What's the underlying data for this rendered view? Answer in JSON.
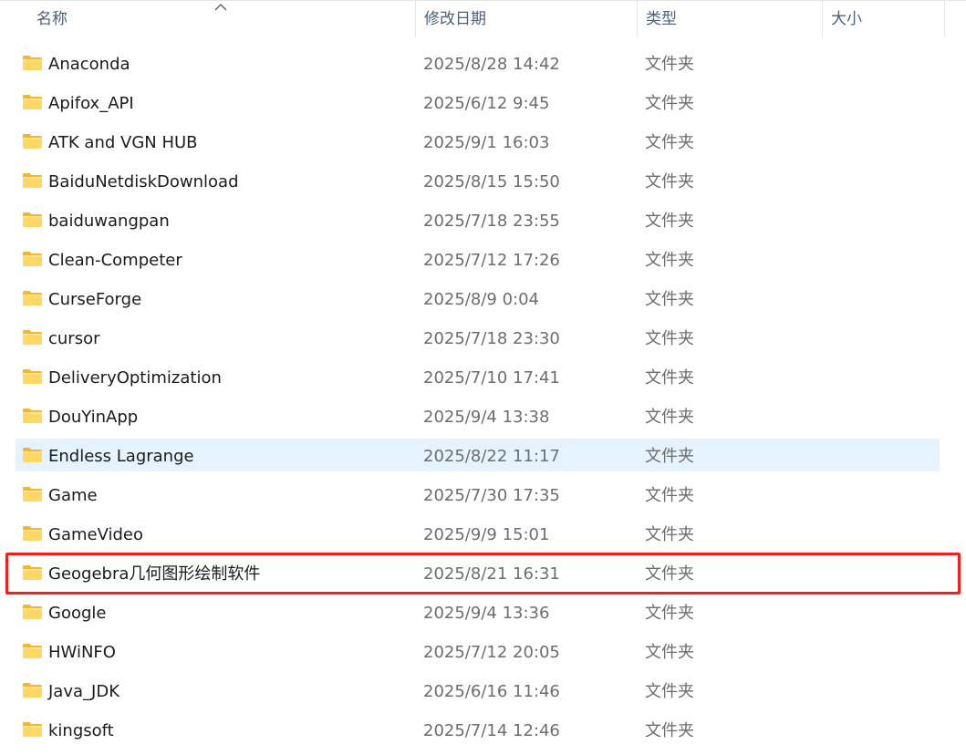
{
  "columns": {
    "name": "名称",
    "date": "修改日期",
    "type": "类型",
    "size": "大小"
  },
  "rows": [
    {
      "name": "Anaconda",
      "date": "2025/8/28 14:42",
      "type": "文件夹"
    },
    {
      "name": "Apifox_API",
      "date": "2025/6/12 9:45",
      "type": "文件夹"
    },
    {
      "name": "ATK and VGN HUB",
      "date": "2025/9/1 16:03",
      "type": "文件夹"
    },
    {
      "name": "BaiduNetdiskDownload",
      "date": "2025/8/15 15:50",
      "type": "文件夹"
    },
    {
      "name": "baiduwangpan",
      "date": "2025/7/18 23:55",
      "type": "文件夹"
    },
    {
      "name": "Clean-Competer",
      "date": "2025/7/12 17:26",
      "type": "文件夹"
    },
    {
      "name": "CurseForge",
      "date": "2025/8/9 0:04",
      "type": "文件夹"
    },
    {
      "name": "cursor",
      "date": "2025/7/18 23:30",
      "type": "文件夹"
    },
    {
      "name": "DeliveryOptimization",
      "date": "2025/7/10 17:41",
      "type": "文件夹"
    },
    {
      "name": "DouYinApp",
      "date": "2025/9/4 13:38",
      "type": "文件夹"
    },
    {
      "name": "Endless Lagrange",
      "date": "2025/8/22 11:17",
      "type": "文件夹"
    },
    {
      "name": "Game",
      "date": "2025/7/30 17:35",
      "type": "文件夹"
    },
    {
      "name": "GameVideo",
      "date": "2025/9/9 15:01",
      "type": "文件夹"
    },
    {
      "name": "Geogebra几何图形绘制软件",
      "date": "2025/8/21 16:31",
      "type": "文件夹"
    },
    {
      "name": "Google",
      "date": "2025/9/4 13:36",
      "type": "文件夹"
    },
    {
      "name": "HWiNFO",
      "date": "2025/7/12 20:05",
      "type": "文件夹"
    },
    {
      "name": "Java_JDK",
      "date": "2025/6/16 11:46",
      "type": "文件夹"
    },
    {
      "name": "kingsoft",
      "date": "2025/7/14 12:46",
      "type": "文件夹"
    }
  ],
  "colors": {
    "folder_fill": "#ffd764",
    "folder_tab": "#f2b632",
    "hover_bg": "#e5f3ff",
    "highlight_border": "#ff1a1a"
  },
  "icons": {
    "sort": "chevron-up-icon",
    "folder": "folder-icon"
  }
}
